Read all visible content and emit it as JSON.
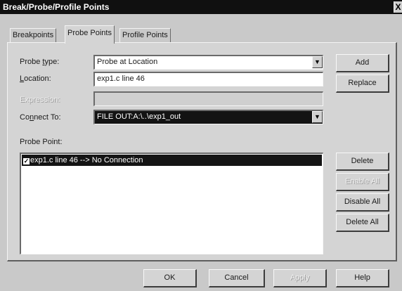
{
  "window": {
    "title": "Break/Probe/Profile Points",
    "close_glyph": "X"
  },
  "tabs": [
    {
      "label": "Breakpoints",
      "active": false
    },
    {
      "label": "Probe Points",
      "active": true
    },
    {
      "label": "Profile Points",
      "active": false
    }
  ],
  "form": {
    "probe_type": {
      "label_pre": "Probe ",
      "label_u": "t",
      "label_post": "ype:",
      "value": "Probe at Location"
    },
    "location": {
      "label_u": "L",
      "label_post": "ocation:",
      "value": "exp1.c line 46"
    },
    "expression": {
      "label": "Expression:",
      "value": ""
    },
    "connect_to": {
      "label_pre": "Co",
      "label_u": "n",
      "label_post": "nect To:",
      "value": "FILE OUT:A:\\..\\exp1_out"
    }
  },
  "probe_point": {
    "label": "Probe Point:",
    "items": [
      {
        "text": "exp1.c line 46 --> No Connection",
        "checked": true,
        "check_glyph": "✓"
      }
    ]
  },
  "side_buttons": {
    "add": "Add",
    "replace": "Replace",
    "delete": "Delete",
    "enable_all": "Enable All",
    "disable_all": "Disable All",
    "delete_all": "Delete All"
  },
  "footer_buttons": {
    "ok": "OK",
    "cancel": "Cancel",
    "apply": "Apply",
    "help": "Help"
  },
  "icons": {
    "dropdown": "▼"
  }
}
